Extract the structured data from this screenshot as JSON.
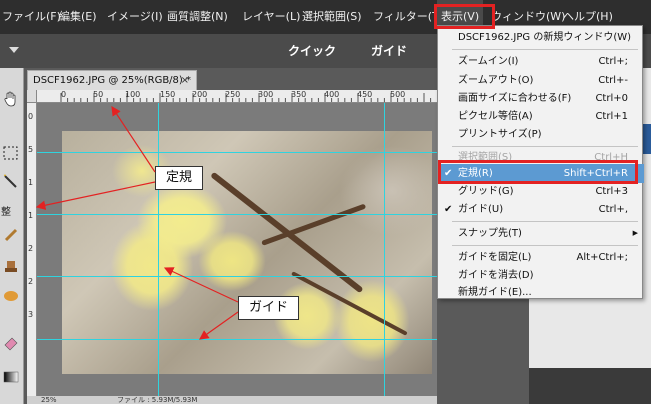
{
  "menubar": {
    "items": [
      "ファイル(F)",
      "編集(E)",
      "イメージ(I)",
      "画質調整(N)",
      "レイヤー(L)",
      "選択範囲(S)",
      "フィルター(T)",
      "表示(V)",
      "ウィンドウ(W)",
      "ヘルプ(H)"
    ],
    "active": "表示(V)"
  },
  "modes": [
    "クイック",
    "ガイド"
  ],
  "document": {
    "tab_title": "DSCF1962.JPG @ 25%(RGB/8) *",
    "close_glyph": "×",
    "zoom": "25%",
    "file_info": "ファイル : 5.93M/5.93M"
  },
  "ruler": {
    "h_ticks": [
      "0",
      "50",
      "100",
      "150",
      "200",
      "250",
      "300",
      "350",
      "400",
      "450",
      "500"
    ],
    "v_ticks": [
      "0",
      "5",
      "1",
      "1",
      "2",
      "2",
      "3"
    ]
  },
  "toolbar": {
    "label": "整"
  },
  "annotations": {
    "ruler_label": "定規",
    "guide_label": "ガイド"
  },
  "view_menu": {
    "items": [
      {
        "label": "DSCF1962.JPG の新規ウィンドウ(W)",
        "shortcut": "",
        "state": "normal"
      },
      {
        "label": "ズームイン(I)",
        "shortcut": "Ctrl+;",
        "state": "normal"
      },
      {
        "label": "ズームアウト(O)",
        "shortcut": "Ctrl+-",
        "state": "normal"
      },
      {
        "label": "画面サイズに合わせる(F)",
        "shortcut": "Ctrl+0",
        "state": "normal"
      },
      {
        "label": "ピクセル等倍(A)",
        "shortcut": "Ctrl+1",
        "state": "normal"
      },
      {
        "label": "プリントサイズ(P)",
        "shortcut": "",
        "state": "normal"
      },
      {
        "label": "選択範囲(S)",
        "shortcut": "Ctrl+H",
        "state": "disabled"
      },
      {
        "label": "定規(R)",
        "shortcut": "Shift+Ctrl+R",
        "state": "checked-highlighted"
      },
      {
        "label": "グリッド(G)",
        "shortcut": "Ctrl+3",
        "state": "normal"
      },
      {
        "label": "ガイド(U)",
        "shortcut": "Ctrl+,",
        "state": "checked"
      },
      {
        "label": "スナップ先(T)",
        "shortcut": "",
        "state": "submenu"
      },
      {
        "label": "ガイドを固定(L)",
        "shortcut": "Alt+Ctrl+;",
        "state": "normal"
      },
      {
        "label": "ガイドを消去(D)",
        "shortcut": "",
        "state": "normal"
      },
      {
        "label": "新規ガイド(E)...",
        "shortcut": "",
        "state": "normal"
      }
    ],
    "check_glyph": "✔",
    "submenu_glyph": "▶"
  },
  "colors": {
    "guide": "#2fd3df",
    "highlight": "#5c9ad2",
    "annotation_red": "#e32222"
  }
}
